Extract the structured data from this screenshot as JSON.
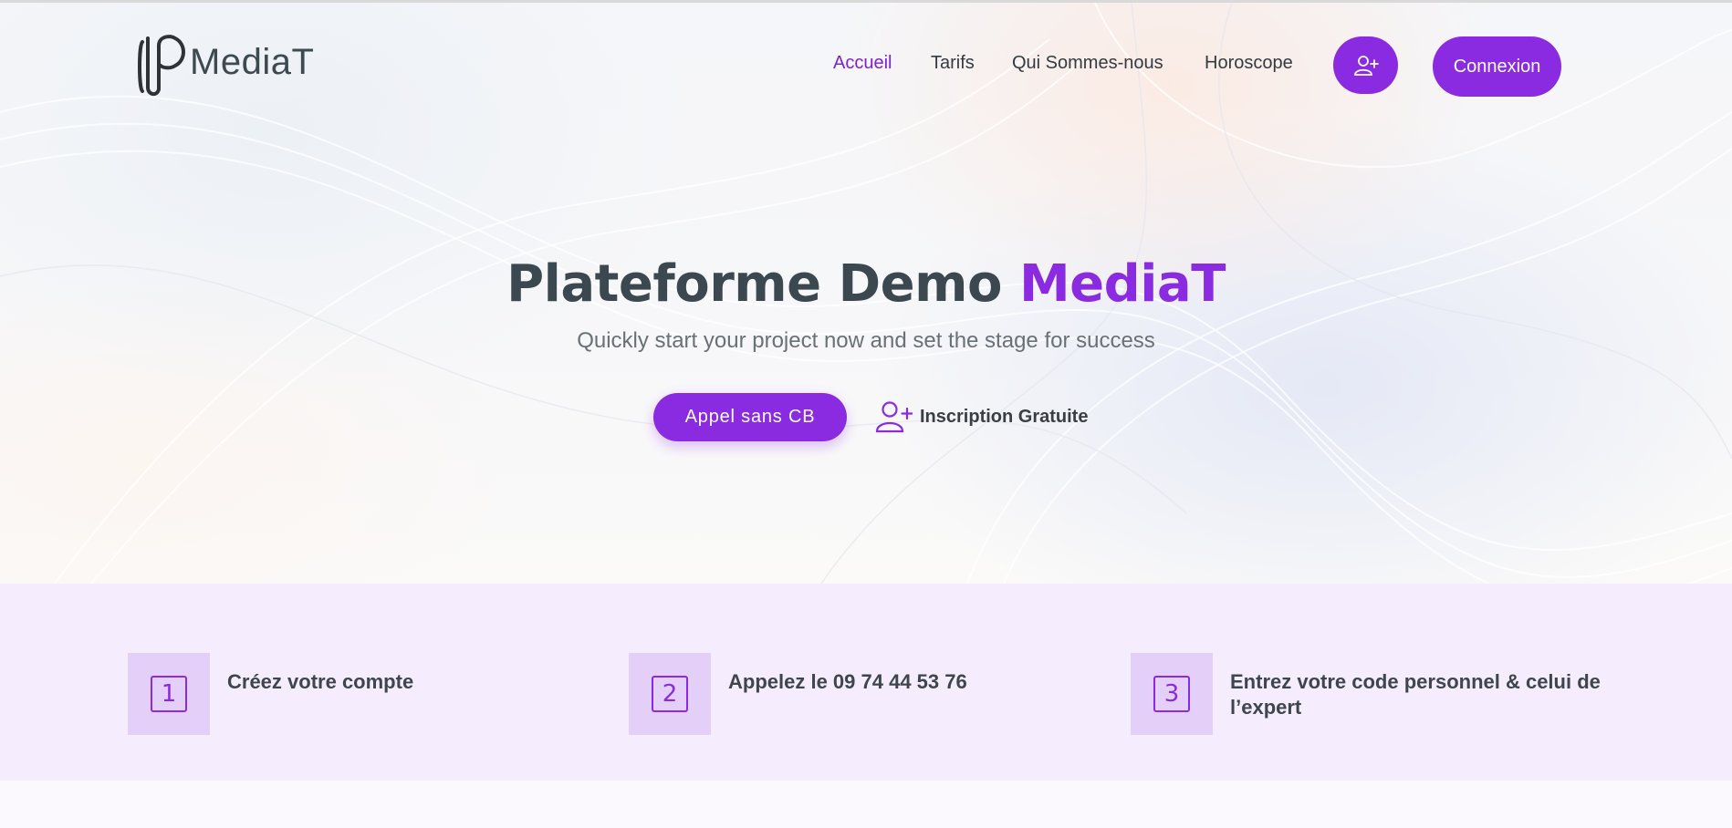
{
  "brand": {
    "logo_text": "MediaT"
  },
  "nav": {
    "links": [
      "Accueil",
      "Tarifs",
      "Qui Sommes-nous",
      "Horoscope"
    ],
    "login_label": "Connexion"
  },
  "hero": {
    "title_main": "Plateforme Demo",
    "title_brand": "MediaT",
    "subtitle": "Quickly start your project now and set the stage for success",
    "cta_primary": "Appel sans CB",
    "cta_secondary": "Inscription Gratuite"
  },
  "steps": [
    {
      "number": "1",
      "text": "Créez votre compte"
    },
    {
      "number": "2",
      "text": "Appelez le 09 74 44 53 76"
    },
    {
      "number": "3",
      "text": "Entrez votre code personnel & celui de l’expert"
    }
  ],
  "colors": {
    "accent": "#8a2be2",
    "text": "#3b4850",
    "steps_background": "#f5edfd",
    "step_box": "#e3cff8"
  },
  "icons": {
    "logo": "mediat-logo-icon",
    "signup": "user-plus-icon",
    "step_frame": "square-number-icon"
  }
}
